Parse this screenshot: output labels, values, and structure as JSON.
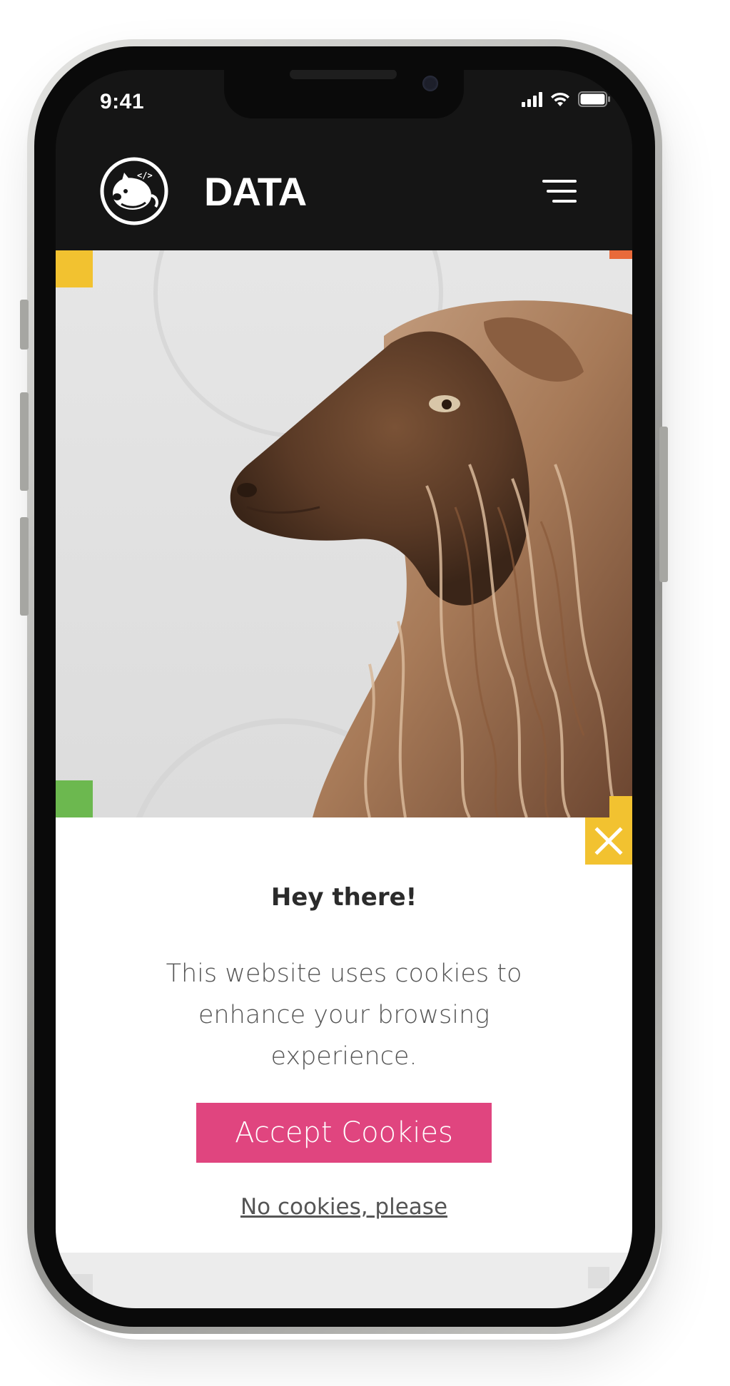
{
  "status_bar": {
    "time": "9:41"
  },
  "header": {
    "brand": "DATA",
    "logo_icon": "pig-coder-logo-icon",
    "menu_icon": "hamburger-menu-icon"
  },
  "hero": {
    "image": "sheep-portrait-photo",
    "accent_colors": {
      "yellow": "#f2c230",
      "green": "#6cb84f",
      "orange": "#e86a3a"
    }
  },
  "cookie_banner": {
    "title": "Hey there!",
    "message": "This website uses cookies to enhance your browsing experience.",
    "accept_label": "Accept Cookies",
    "decline_label": "No cookies, please",
    "close_icon": "close-icon",
    "colors": {
      "accept_button": "#e0457f",
      "close_button": "#f2c230"
    }
  }
}
